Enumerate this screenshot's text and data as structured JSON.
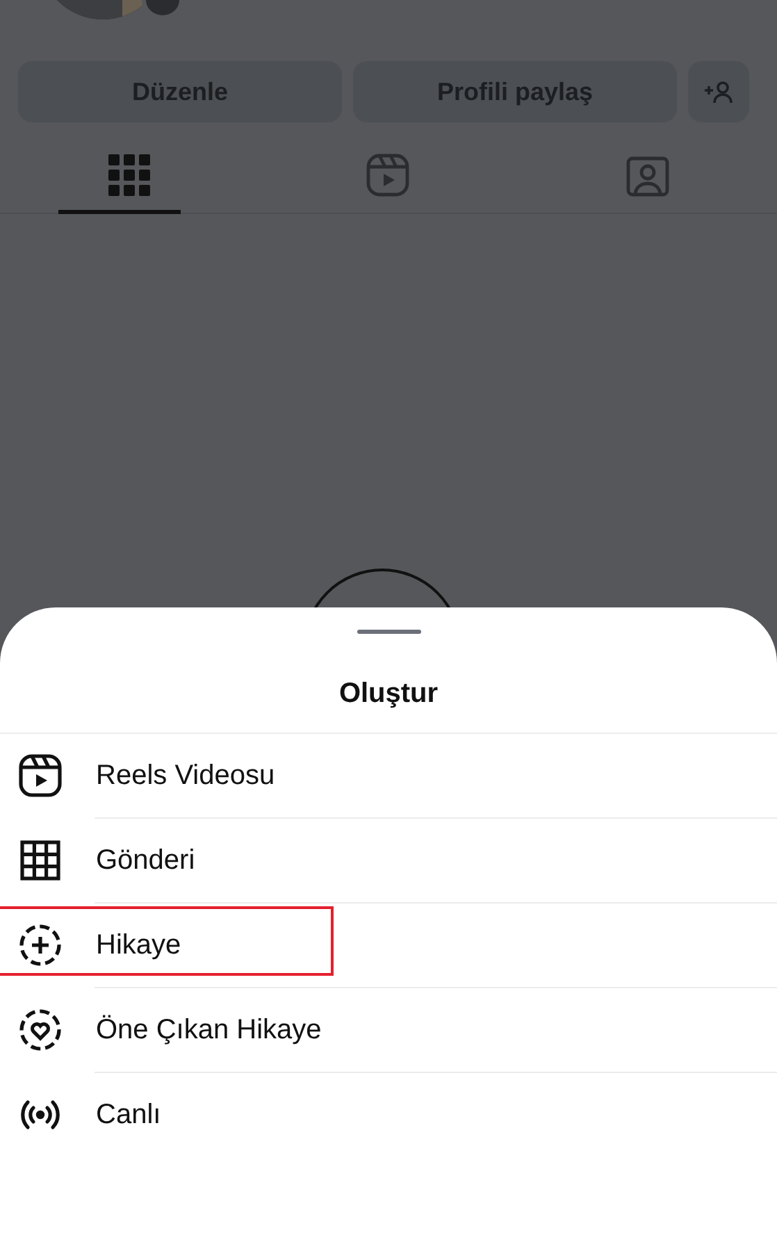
{
  "profile": {
    "buttons": [
      "Düzenle",
      "Profili paylaş"
    ],
    "tabs": [
      {
        "selected": true
      },
      {
        "selected": false
      },
      {
        "selected": false
      }
    ]
  },
  "sheet": {
    "title": "Oluştur",
    "items": [
      {
        "label": "Reels Videosu",
        "highlighted": false
      },
      {
        "label": "Gönderi",
        "highlighted": false
      },
      {
        "label": "Hikaye",
        "highlighted": true
      },
      {
        "label": "Öne Çıkan Hikaye",
        "highlighted": false
      },
      {
        "label": "Canlı",
        "highlighted": false
      }
    ]
  }
}
